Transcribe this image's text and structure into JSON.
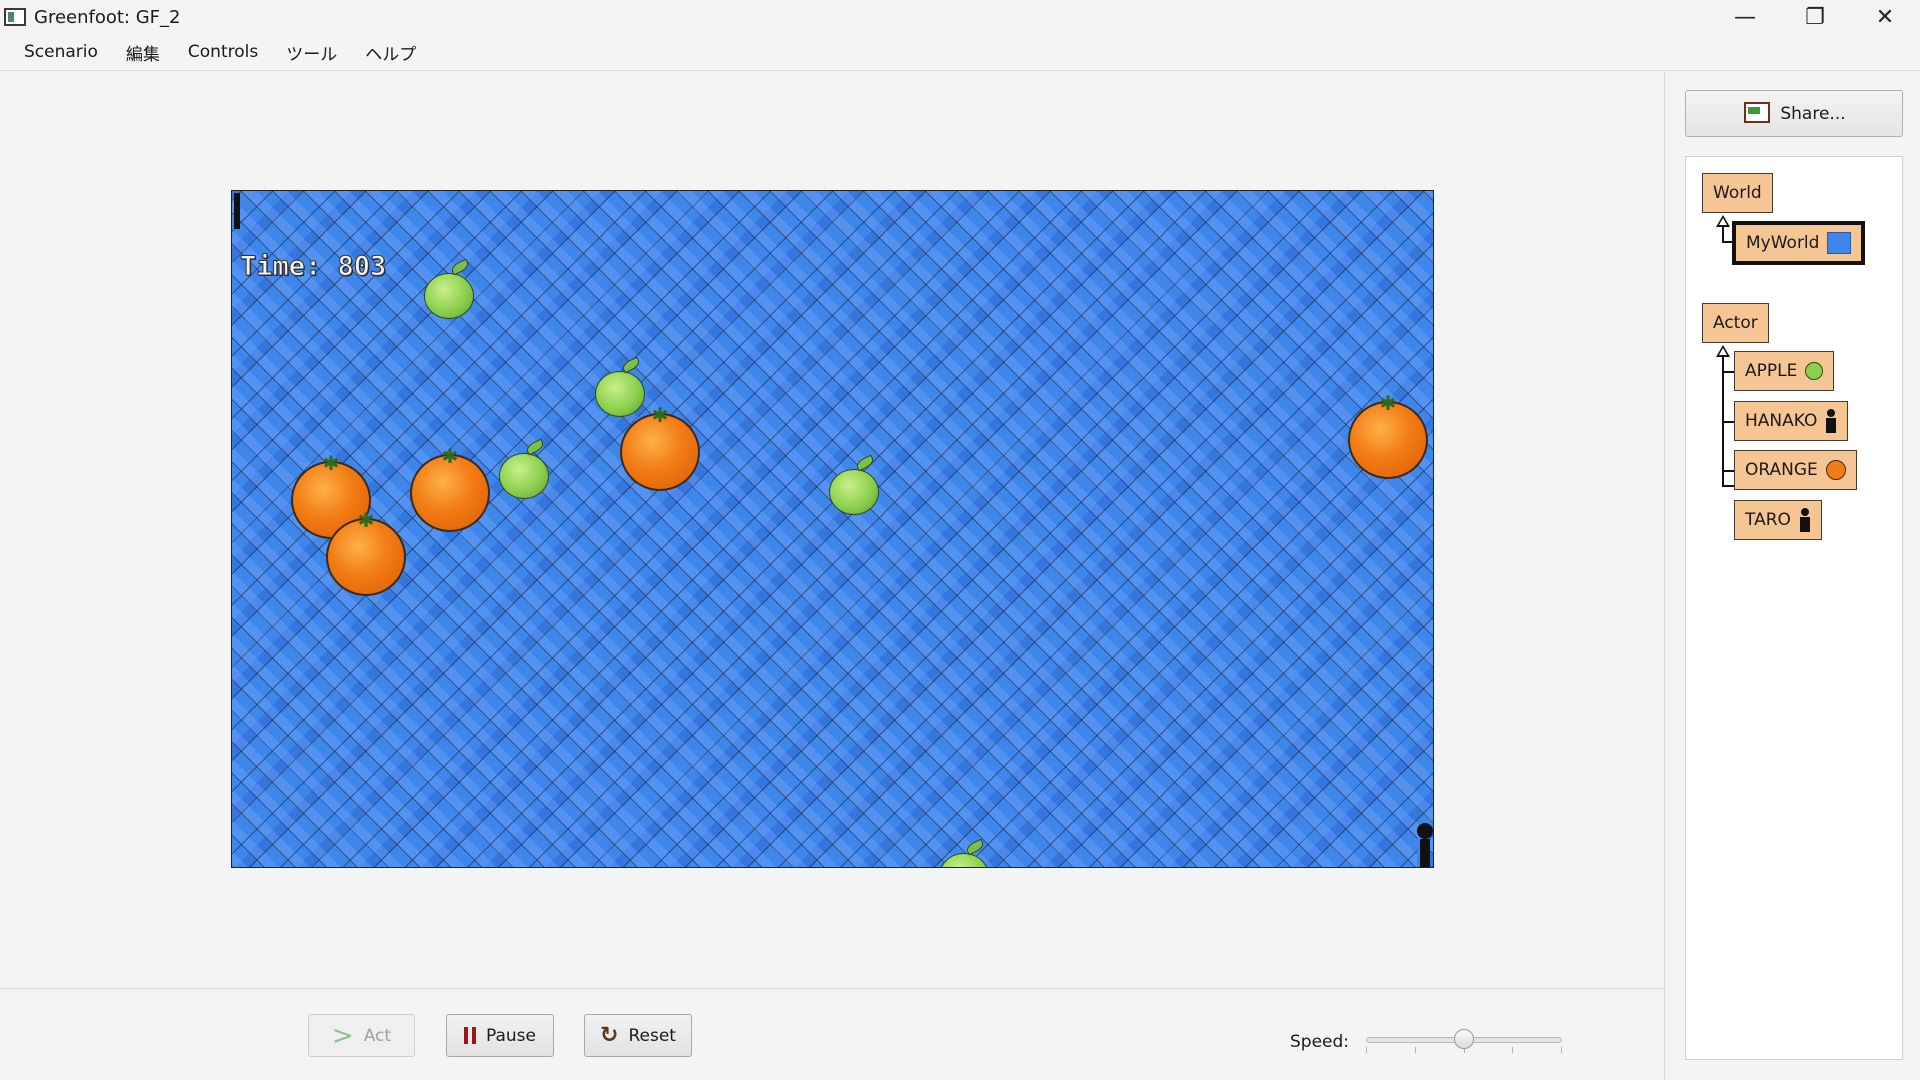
{
  "window": {
    "title": "Greenfoot: GF_2",
    "minimize": "—",
    "restore": "❐",
    "close": "✕"
  },
  "menu": [
    "Scenario",
    "編集",
    "Controls",
    "ツール",
    "ヘルプ"
  ],
  "world": {
    "time_text": "Time: 803"
  },
  "controls": {
    "act_label": "Act",
    "pause_label": "Pause",
    "reset_label": "Reset",
    "speed_label": "Speed:",
    "speed_value": 0.5
  },
  "share": {
    "label": "Share..."
  },
  "class_tree": {
    "world_root": "World",
    "world_sub": "MyWorld",
    "actor_root": "Actor",
    "actors": [
      "APPLE",
      "HANAKO",
      "ORANGE",
      "TARO"
    ]
  }
}
